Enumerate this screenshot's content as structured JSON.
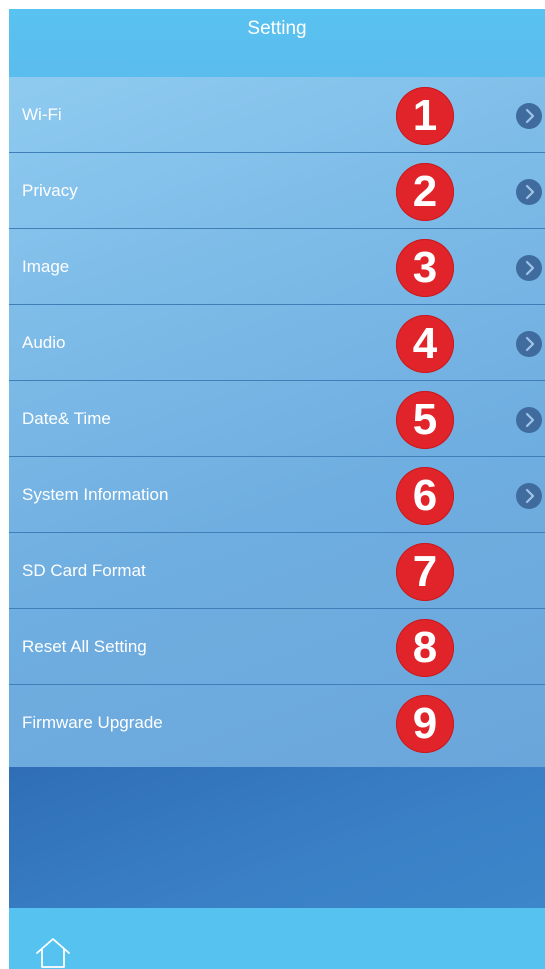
{
  "header": {
    "title": "Setting"
  },
  "settings": {
    "items": [
      {
        "label": "Wi-Fi",
        "badge": "1",
        "has_chevron": true
      },
      {
        "label": "Privacy",
        "badge": "2",
        "has_chevron": true
      },
      {
        "label": "Image",
        "badge": "3",
        "has_chevron": true
      },
      {
        "label": "Audio",
        "badge": "4",
        "has_chevron": true
      },
      {
        "label": "Date& Time",
        "badge": "5",
        "has_chevron": true
      },
      {
        "label": "System Information",
        "badge": "6",
        "has_chevron": true
      },
      {
        "label": "SD Card Format",
        "badge": "7",
        "has_chevron": false
      },
      {
        "label": "Reset All Setting",
        "badge": "8",
        "has_chevron": false
      },
      {
        "label": "Firmware Upgrade",
        "badge": "9",
        "has_chevron": false
      }
    ]
  },
  "footer": {
    "icon": "home-icon"
  },
  "colors": {
    "header": "#58c2f0",
    "badge": "#e0242a",
    "chevron": "#3f6b9e",
    "footer": "#55c2ef"
  }
}
